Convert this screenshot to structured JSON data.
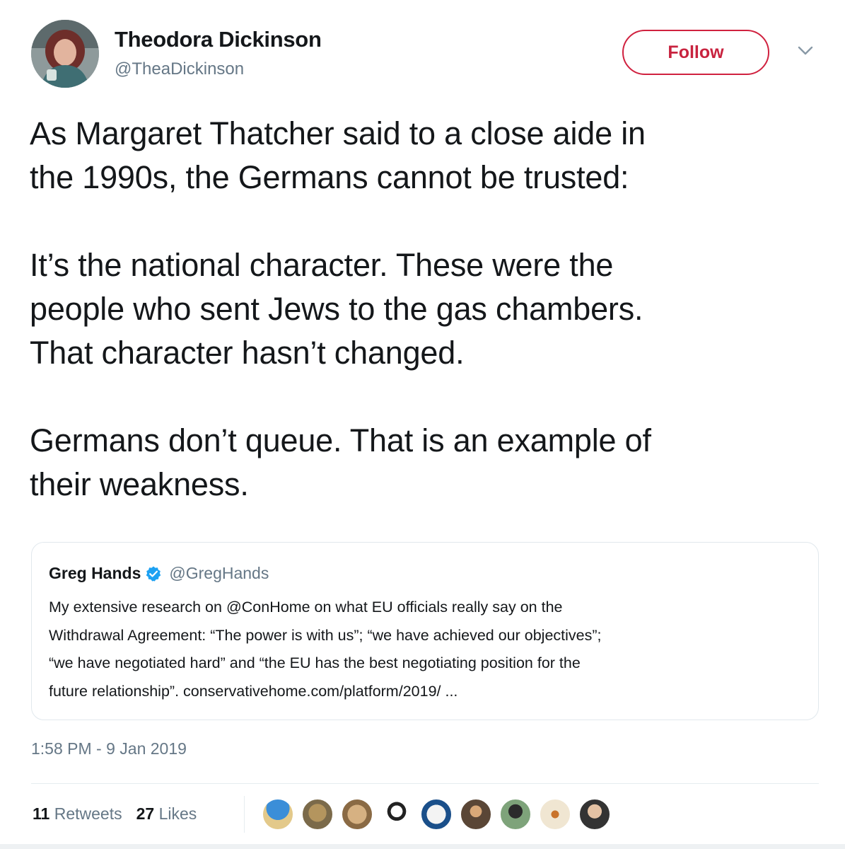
{
  "author": {
    "display_name": "Theodora Dickinson",
    "handle": "@TheaDickinson"
  },
  "follow_label": "Follow",
  "tweet_text": {
    "line1": "As Margaret Thatcher said to a close aide in",
    "line2": "the 1990s, the Germans cannot be trusted:",
    "line3": "It’s the national character. These were the",
    "line4": "people who sent Jews to the gas chambers.",
    "line5": "That character hasn’t changed.",
    "line6": "Germans don’t queue. That is an example of",
    "line7": "their weakness."
  },
  "quoted_tweet": {
    "display_name": "Greg Hands",
    "handle": "@GregHands",
    "line1": "My extensive research on @ConHome on what EU officials really say on the",
    "line2": "Withdrawal Agreement: “The power is with us”; “we have achieved our objectives”;",
    "line3": "“we have negotiated hard” and “the EU has the best negotiating position for the",
    "line4": "future relationship”. conservativehome.com/platform/2019/  ..."
  },
  "timestamp": "1:58 PM - 9 Jan 2019",
  "stats": {
    "retweets_count": "11",
    "retweets_label": "Retweets",
    "likes_count": "27",
    "likes_label": "Likes"
  },
  "colors": {
    "follow_accent": "#c8233f",
    "verified_badge": "#1da1f2",
    "secondary_text": "#657786"
  },
  "icons": {
    "caret": "chevron-down-icon",
    "verified": "verified-badge-icon"
  }
}
